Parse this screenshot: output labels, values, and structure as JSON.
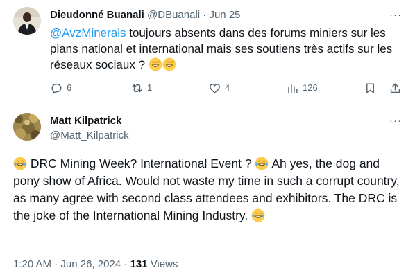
{
  "reply": {
    "display_name": "Dieudonné Buanali",
    "handle": "@DBuanali",
    "separator": "·",
    "date": "Jun 25",
    "mention": "@AvzMinerals",
    "text": " toujours absents dans des forums miniers sur les plans national et international mais ses soutiens très actifs sur les réseaux sociaux ? ",
    "trailing_emojis": [
      "grinning-sweat-emoji",
      "grinning-sweat-emoji"
    ],
    "actions": {
      "replies": "6",
      "reposts": "1",
      "likes": "4",
      "views": "126"
    },
    "more_label": "···"
  },
  "main": {
    "display_name": "Matt Kilpatrick",
    "handle": "@Matt_Kilpatrick",
    "segments": [
      {
        "type": "emoji",
        "name": "tears-of-joy-emoji"
      },
      {
        "type": "text",
        "value": " DRC Mining Week? International Event ? "
      },
      {
        "type": "emoji",
        "name": "tears-of-joy-emoji"
      },
      {
        "type": "text",
        "value": " Ah yes, the dog and pony show of Africa. Would not waste my time in such a corrupt country, as many agree with second class attendees and exhibitors. The DRC is the joke of the International Mining Industry. "
      },
      {
        "type": "emoji",
        "name": "tears-of-joy-emoji"
      }
    ],
    "time": "1:20 AM",
    "separator": "·",
    "date": "Jun 26, 2024",
    "views_count": "131",
    "views_label": "Views",
    "more_label": "···"
  },
  "colors": {
    "text": "#0f1419",
    "muted": "#536471",
    "link": "#1d9bf0",
    "emoji_face": "#ffcc4d"
  }
}
